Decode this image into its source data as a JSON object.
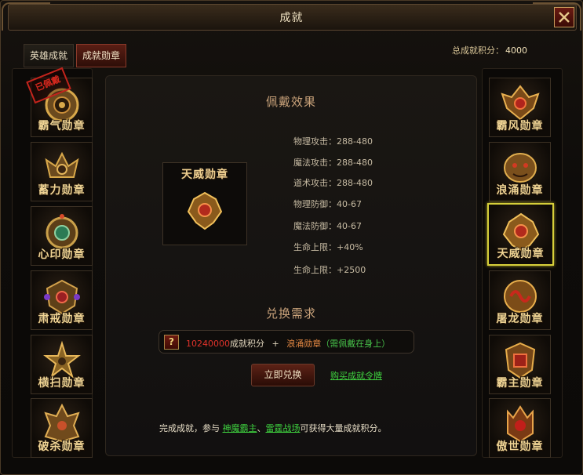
{
  "window": {
    "title": "成就"
  },
  "tabs": [
    {
      "label": "英雄成就",
      "active": false
    },
    {
      "label": "成就勋章",
      "active": true
    }
  ],
  "total_score": {
    "label": "总成就积分：",
    "value": "4000"
  },
  "left_medals": [
    {
      "name": "霸气勋章",
      "stamp": "已佩戴",
      "icon": "medal-dragon-ring-icon"
    },
    {
      "name": "蓄力勋章",
      "icon": "medal-winged-helm-icon"
    },
    {
      "name": "心印勋章",
      "icon": "medal-jade-amulet-icon"
    },
    {
      "name": "肃戒勋章",
      "icon": "medal-gem-shield-icon"
    },
    {
      "name": "横扫勋章",
      "icon": "medal-star-emblem-icon"
    },
    {
      "name": "破杀勋章",
      "icon": "medal-spiked-crest-icon"
    }
  ],
  "right_medals": [
    {
      "name": "霸风勋章",
      "icon": "medal-phoenix-icon"
    },
    {
      "name": "浪涌勋章",
      "icon": "medal-beast-mask-icon"
    },
    {
      "name": "天威勋章",
      "icon": "medal-tianwei-icon",
      "selected": true
    },
    {
      "name": "屠龙勋章",
      "icon": "medal-dragon-coil-icon"
    },
    {
      "name": "霸主勋章",
      "icon": "medal-warlord-icon"
    },
    {
      "name": "傲世勋章",
      "icon": "medal-crowned-demon-icon"
    }
  ],
  "effect": {
    "title": "佩戴效果",
    "preview_name": "天威勋章",
    "stats": [
      "物理攻击：288-480",
      "魔法攻击：288-480",
      "道术攻击：288-480",
      "物理防御：40-67",
      "魔法防御：40-67",
      "生命上限：+40%",
      "生命上限：+2500"
    ]
  },
  "requirement": {
    "title": "兑换需求",
    "help": "?",
    "score_value": "10240000",
    "score_label": "成就积分",
    "plus": "+",
    "medal_name": "浪涌勋章",
    "medal_note": "（需佩戴在身上）"
  },
  "actions": {
    "redeem": "立即兑换",
    "buy": "购买成就令牌"
  },
  "footer": {
    "prefix": "完成成就，参与 ",
    "link1": "神魔霸主",
    "sep": "、",
    "link2": "雷霆战场",
    "suffix": "可获得大量成就积分。"
  },
  "colors": {
    "gold": "#f0d494",
    "selected_border": "#d6cf3a",
    "link_green": "#3fd23f",
    "score_red": "#e0322a"
  }
}
